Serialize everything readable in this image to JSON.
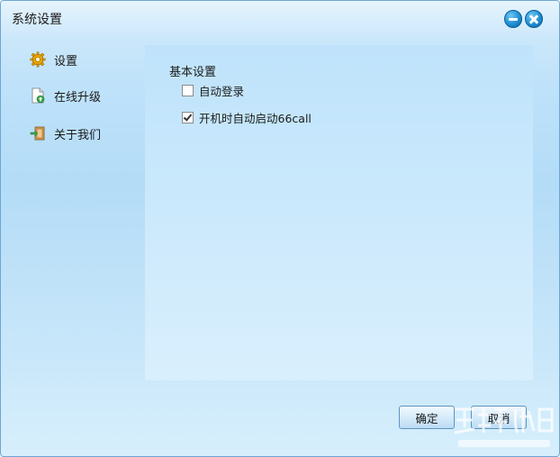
{
  "window": {
    "title": "系统设置"
  },
  "sidebar": {
    "items": [
      {
        "label": "设置",
        "icon": "gear-icon"
      },
      {
        "label": "在线升级",
        "icon": "document-upgrade-icon"
      },
      {
        "label": "关于我们",
        "icon": "door-exit-icon"
      }
    ]
  },
  "panel": {
    "section_title": "基本设置",
    "options": [
      {
        "label": "自动登录",
        "checked": false
      },
      {
        "label": "开机时自动启动66call",
        "checked": true
      }
    ]
  },
  "footer": {
    "ok_label": "确定",
    "cancel_label": "取消"
  },
  "colors": {
    "accent": "#1f8fd3",
    "panel_bg": "#cbe9fc",
    "window_bg": "#b4dcf7"
  }
}
